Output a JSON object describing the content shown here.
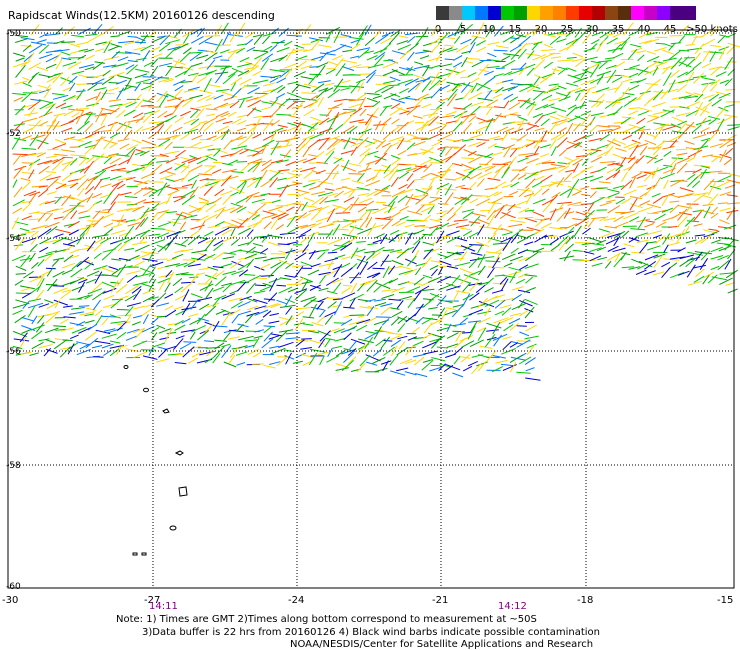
{
  "title": "Rapidscat Winds(12.5KM) 20160126 descending",
  "legend": {
    "labels": [
      "0",
      "5",
      "10",
      "15",
      "20",
      "25",
      "30",
      "35",
      "40",
      "45",
      ">50 knots"
    ],
    "colors": [
      "#3a3a3a",
      "#8a8a8a",
      "#00c8ff",
      "#0078ff",
      "#0000d2",
      "#00c800",
      "#00a000",
      "#ffd700",
      "#ffa000",
      "#ff8000",
      "#ff3c00",
      "#e60000",
      "#b40000",
      "#8b4513",
      "#5a2d0c",
      "#ff00ff",
      "#c800c8",
      "#8c00ff",
      "#4b0082",
      "#4b0082"
    ]
  },
  "axes": {
    "lon_ticks": [
      "-30",
      "-27",
      "-24",
      "-21",
      "-18",
      "-15"
    ],
    "lat_ticks": [
      "-50",
      "-52",
      "-54",
      "-56",
      "-58",
      "-60"
    ],
    "lat_values": [
      -50,
      -52,
      -54,
      -56,
      -58,
      -60
    ]
  },
  "times": {
    "t1": "14:11",
    "t2": "14:12"
  },
  "notes": {
    "line1": "Note: 1) Times are GMT 2)Times along bottom correspond to measurement at ~50S",
    "line2": "3)Data buffer is 22 hrs from 20160126 4) Black wind barbs indicate possible contamination",
    "line3": "NOAA/NESDIS/Center for Satellite Applications and Research"
  },
  "map": {
    "lon_range": [
      -30,
      -15
    ],
    "lat_range": [
      -60,
      -49.9
    ],
    "wind_field_colors": [
      "#00c800",
      "#00a000",
      "#ffd700",
      "#ffa000",
      "#0000d2",
      "#ff3c00"
    ],
    "islands": "South Sandwich Islands"
  }
}
